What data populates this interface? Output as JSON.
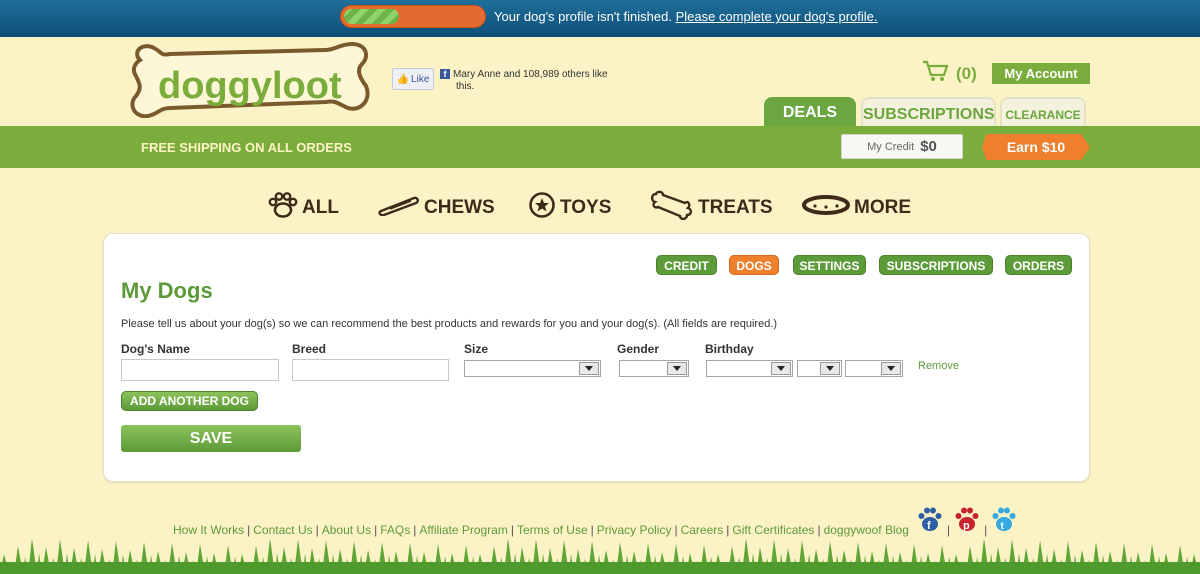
{
  "banner": {
    "progress_fraction": 0.4,
    "message": "Your dog's profile isn't finished.",
    "link_text": "Please complete your dog's profile."
  },
  "header": {
    "logo_text": "doggyloot",
    "fb_like_label": "Like",
    "fb_social_line1": "Mary Anne and 108,989 others like",
    "fb_social_line2": "this.",
    "cart_count": "(0)",
    "my_account": "My Account",
    "tabs": [
      "DEALS",
      "SUBSCRIPTIONS",
      "CLEARANCE"
    ]
  },
  "promo_bar": {
    "free_shipping": "FREE SHIPPING ON ALL ORDERS",
    "credit_label": "My Credit",
    "credit_value": "$0",
    "earn_label": "Earn $10"
  },
  "categories": [
    "ALL",
    "CHEWS",
    "TOYS",
    "TREATS",
    "MORE"
  ],
  "account_tabs": [
    "CREDIT",
    "DOGS",
    "SETTINGS",
    "SUBSCRIPTIONS",
    "ORDERS"
  ],
  "main": {
    "title": "My Dogs",
    "intro": "Please tell us about your dog(s) so we can recommend the best products and rewards for you and your dog(s). (All fields are required.)",
    "labels": {
      "name": "Dog's Name",
      "breed": "Breed",
      "size": "Size",
      "gender": "Gender",
      "birthday": "Birthday"
    },
    "values": {
      "name": "",
      "breed": "",
      "size": "",
      "gender": "",
      "month": "",
      "day": "",
      "year": ""
    },
    "remove_link": "Remove",
    "add_button": "ADD ANOTHER DOG",
    "save_button": "SAVE"
  },
  "footer": {
    "links": [
      "How It Works",
      "Contact Us",
      "About Us",
      "FAQs",
      "Affiliate Program",
      "Terms of Use",
      "Privacy Policy",
      "Careers",
      "Gift Certificates",
      "doggywoof Blog"
    ],
    "social_icons": [
      "facebook-icon",
      "pinterest-icon",
      "twitter-icon"
    ]
  },
  "colors": {
    "brand_green": "#7aad3c",
    "accent_orange": "#ee7f2d",
    "banner_blue": "#1f6f9a",
    "background": "#fbf3c6"
  }
}
